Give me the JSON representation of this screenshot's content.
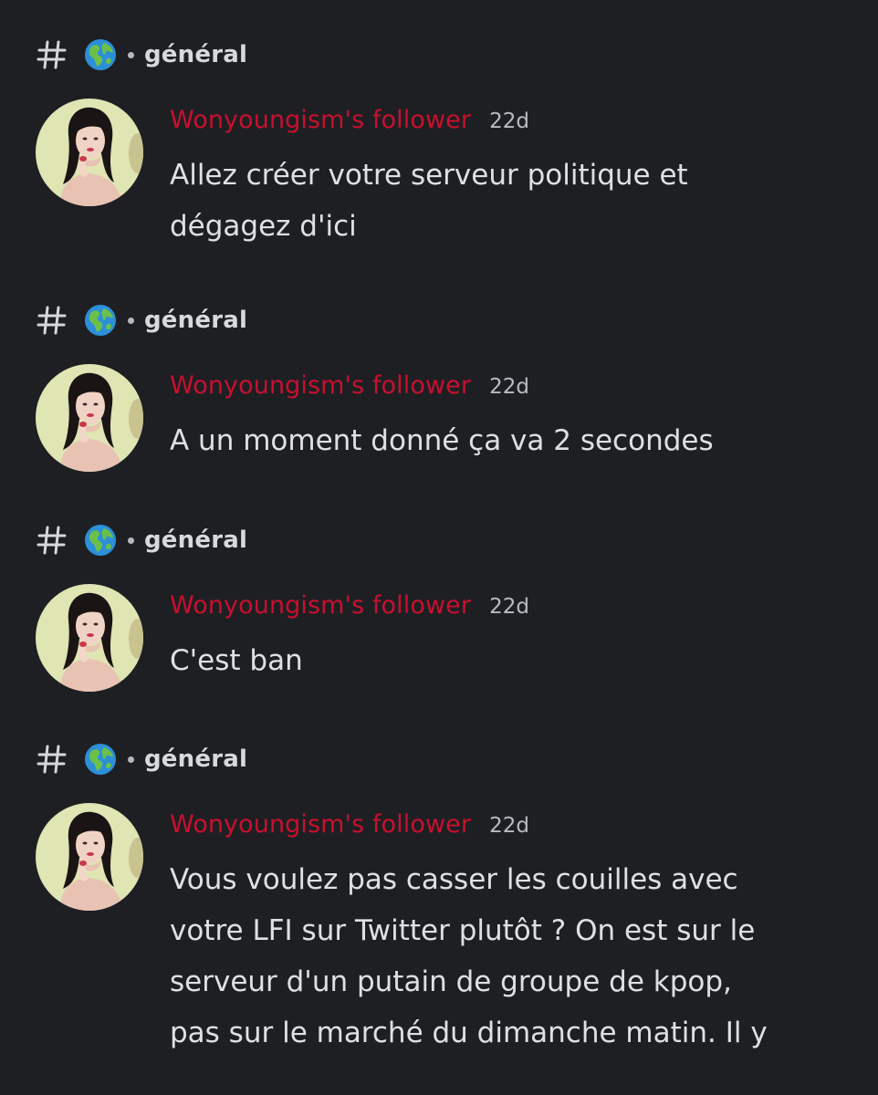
{
  "results": [
    {
      "channel": {
        "icon": "hash-icon",
        "emoji": "globe-icon",
        "name": "général"
      },
      "author": "Wonyoungism's follower",
      "timestamp": "22d",
      "message": "Allez créer votre serveur politique et\ndégagez d'ici"
    },
    {
      "channel": {
        "icon": "hash-icon",
        "emoji": "globe-icon",
        "name": "général"
      },
      "author": "Wonyoungism's follower",
      "timestamp": "22d",
      "message": "A un moment donné ça va 2 secondes"
    },
    {
      "channel": {
        "icon": "hash-icon",
        "emoji": "globe-icon",
        "name": "général"
      },
      "author": "Wonyoungism's follower",
      "timestamp": "22d",
      "message": "C'est ban"
    },
    {
      "channel": {
        "icon": "hash-icon",
        "emoji": "globe-icon",
        "name": "général"
      },
      "author": "Wonyoungism's follower",
      "timestamp": "22d",
      "message": "Vous voulez pas casser les couilles avec\nvotre LFI sur Twitter plutôt ? On est sur le\nserveur d'un putain de groupe de kpop,\npas sur le marché du dimanche matin. Il y"
    }
  ],
  "colors": {
    "background": "#1e1f23",
    "author": "#c8102e",
    "text": "#dfe0e4",
    "muted": "#b9bbc1"
  }
}
